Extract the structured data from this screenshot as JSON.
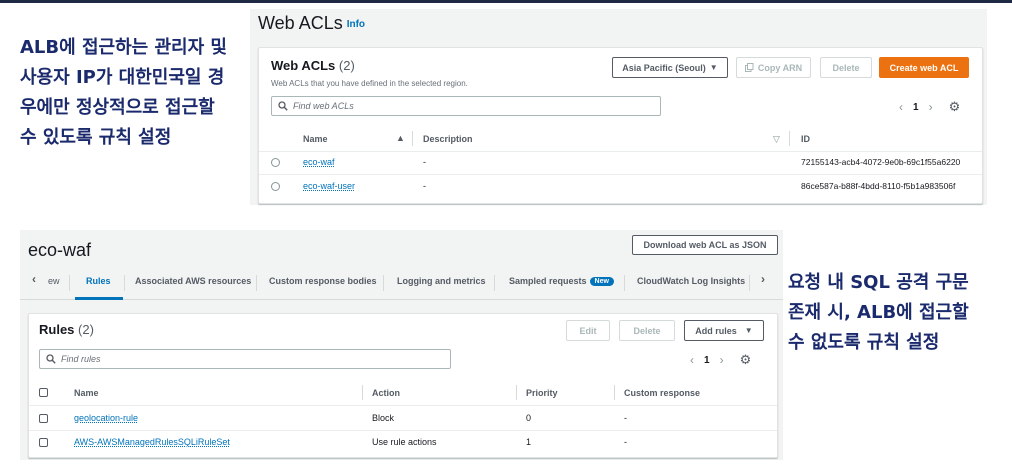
{
  "notes": {
    "left": "ALB에 접근하는 관리자 및 사용자 IP가 대한민국일 경우에만 정상적으로 접근할 수 있도록 규칙 설정",
    "right": "요청 내 SQL 공격 구문 존재 시, ALB에 접근할 수 없도록 규칙 설정"
  },
  "web_acls": {
    "page_title": "Web ACLs",
    "info_link": "Info",
    "card_title": "Web ACLs",
    "count": "(2)",
    "description": "Web ACLs that you have defined in the selected region.",
    "region_select": "Asia Pacific (Seoul)",
    "copy_arn": "Copy ARN",
    "delete": "Delete",
    "create": "Create web ACL",
    "search_placeholder": "Find web ACLs",
    "page_number": "1",
    "columns": {
      "name": "Name",
      "description": "Description",
      "id": "ID"
    },
    "rows": [
      {
        "name": "eco-waf",
        "description": "-",
        "id": "72155143-acb4-4072-9e0b-69c1f55a6220"
      },
      {
        "name": "eco-waf-user",
        "description": "-",
        "id": "86ce587a-b88f-4bdd-8110-f5b1a983506f"
      }
    ]
  },
  "eco_waf": {
    "title": "eco-waf",
    "download_button": "Download web ACL as JSON",
    "tabs": {
      "overview_partial": "ew",
      "rules": "Rules",
      "associated": "Associated AWS resources",
      "custom_response": "Custom response bodies",
      "logging": "Logging and metrics",
      "sampled": "Sampled requests",
      "new_badge": "New",
      "cloudwatch": "CloudWatch Log Insights"
    },
    "card_title": "Rules",
    "count": "(2)",
    "edit": "Edit",
    "delete": "Delete",
    "add_rules": "Add rules",
    "search_placeholder": "Find rules",
    "page_number": "1",
    "columns": {
      "name": "Name",
      "action": "Action",
      "priority": "Priority",
      "custom_response": "Custom response"
    },
    "rows": [
      {
        "name": "geolocation-rule",
        "action": "Block",
        "priority": "0",
        "custom_response": "-"
      },
      {
        "name": "AWS-AWSManagedRulesSQLiRuleSet",
        "action": "Use rule actions",
        "priority": "1",
        "custom_response": "-"
      }
    ]
  },
  "colors": {
    "accent": "#0073bb",
    "primary_button": "#ec7211",
    "note_text": "#1a2a6c"
  },
  "icons": [
    "search-icon",
    "gear-icon",
    "caret-down-icon",
    "copy-icon",
    "chevron-left-icon",
    "chevron-right-icon",
    "sort-up-icon",
    "sort-down-icon"
  ]
}
